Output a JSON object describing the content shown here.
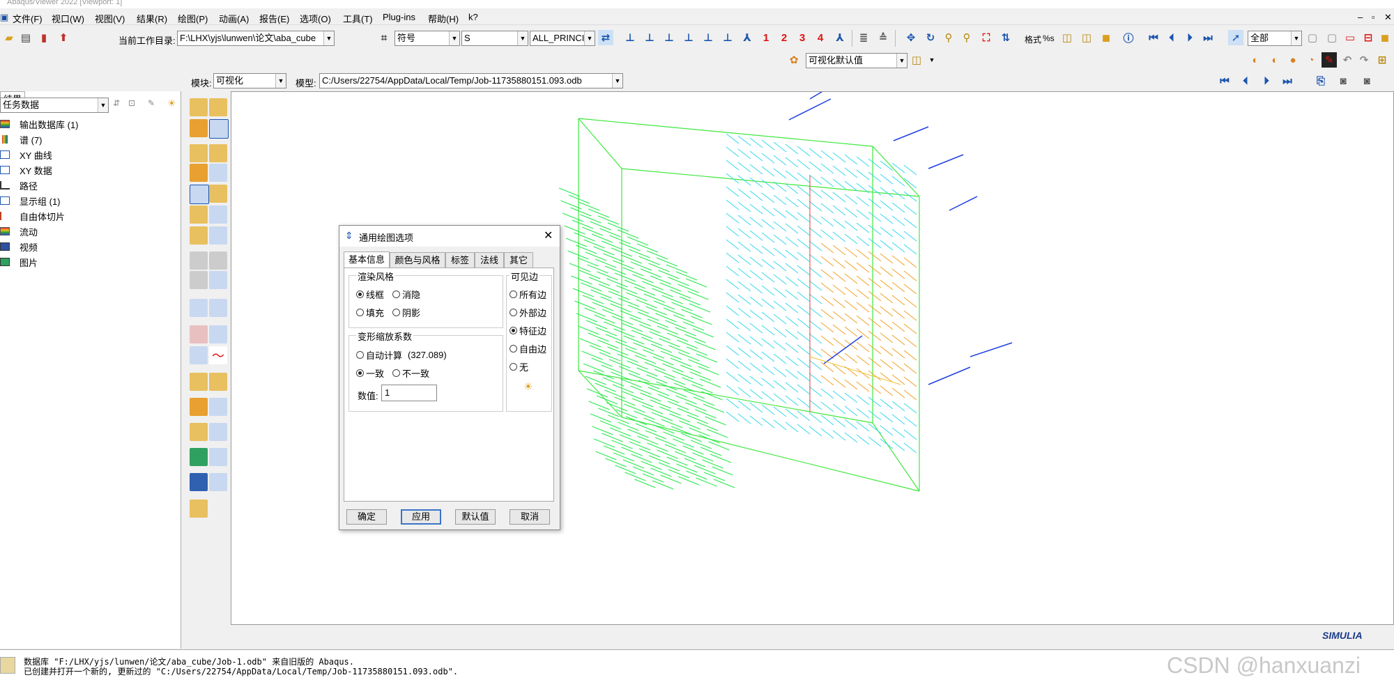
{
  "window": {
    "title": "Abaqus/Viewer 2022 [Viewport: 1]"
  },
  "menu": [
    "文件(F)",
    "视口(W)",
    "视图(V)",
    "结果(R)",
    "绘图(P)",
    "动画(A)",
    "报告(E)",
    "选项(O)",
    "工具(T)",
    "Plug-ins",
    "帮助(H)",
    "k?"
  ],
  "toolbar": {
    "workdir_label": "当前工作目录:",
    "workdir_value": "F:\\LHX\\yjs\\lunwen\\论文\\aba_cube",
    "symbol_value": "符号",
    "variable_value": "S",
    "invariant_value": "ALL_PRINCIPAL",
    "numbers": [
      "1",
      "2",
      "3",
      "4"
    ],
    "format_label": "格式",
    "format_value": "%s",
    "select_value": "全部",
    "defaults_value": "可视化默认值"
  },
  "module_bar": {
    "module_label": "模块:",
    "module_value": "可视化",
    "model_label": "模型:",
    "model_value": "C:/Users/22754/AppData/Local/Temp/Job-11735880151.093.odb"
  },
  "left_panel": {
    "tab": "结果",
    "filter": "任务数据",
    "items": [
      "输出数据库 (1)",
      "谱 (7)",
      "XY 曲线",
      "XY 数据",
      "路径",
      "显示组 (1)",
      "自由体切片",
      "流动",
      "视频",
      "图片"
    ]
  },
  "dialog": {
    "title": "通用绘图选项",
    "tabs": [
      "基本信息",
      "颜色与风格",
      "标签",
      "法线",
      "其它"
    ],
    "render_group": "渲染风格",
    "render_options": [
      "线框",
      "消隐",
      "填充",
      "阴影"
    ],
    "render_selected": "线框",
    "edges_group": "可见边",
    "edges_options": [
      "所有边",
      "外部边",
      "特征边",
      "自由边",
      "无"
    ],
    "edges_selected": "特征边",
    "deform_group": "变形缩放系数",
    "auto_label": "自动计算",
    "auto_value": "(327.089)",
    "uniform_options": [
      "一致",
      "不一致"
    ],
    "uniform_selected": "一致",
    "value_label": "数值:",
    "value": "1",
    "buttons": [
      "确定",
      "应用",
      "默认值",
      "取消"
    ]
  },
  "messages": [
    "数据库 \"F:/LHX/yjs/lunwen/论文/aba_cube/Job-1.odb\" 来自旧版的 Abaqus.",
    "已创建并打开一个新的, 更新过的 \"C:/Users/22754/AppData/Local/Temp/Job-11735880151.093.odb\"."
  ],
  "brand": "SIMULIA",
  "watermark": "CSDN @hanxuanzi",
  "colors": {
    "arrows_green": "#22e84a",
    "arrows_cyan": "#30d8e8",
    "arrows_orange": "#f0a020",
    "arrows_blue": "#2040e0",
    "number_red": "#e01010"
  }
}
